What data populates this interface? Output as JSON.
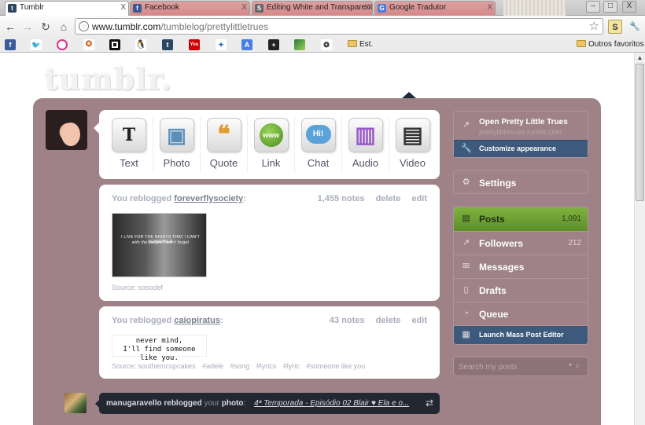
{
  "tabs": [
    {
      "title": "Tumblr",
      "favicon": "t"
    },
    {
      "title": "Facebook",
      "favicon": "f"
    },
    {
      "title": "Editing White and Transparent",
      "favicon": "S"
    },
    {
      "title": "Google Tradutor",
      "favicon": "G"
    }
  ],
  "window_controls": {
    "minimize": "–",
    "restore": "□",
    "close": "X"
  },
  "address_bar": {
    "domain": "www.tumblr.com",
    "path": "/tumblelog/prettylittletrues"
  },
  "bookmarks": {
    "folder1": "Est.",
    "other": "Outros favoritos"
  },
  "logo": "tumblr.",
  "composer": {
    "post_types": [
      {
        "label": "Text",
        "glyph": "T",
        "icon": "text-post-icon"
      },
      {
        "label": "Photo",
        "glyph": "▣",
        "icon": "photo-post-icon"
      },
      {
        "label": "Quote",
        "glyph": "❝",
        "icon": "quote-post-icon"
      },
      {
        "label": "Link",
        "glyph": "www",
        "icon": "link-post-icon"
      },
      {
        "label": "Chat",
        "glyph": "Hi!",
        "icon": "chat-post-icon"
      },
      {
        "label": "Audio",
        "glyph": "▥",
        "icon": "audio-post-icon"
      },
      {
        "label": "Video",
        "glyph": "▤",
        "icon": "video-post-icon"
      }
    ]
  },
  "posts": [
    {
      "prefix": "You reblogged",
      "user": "foreverflysociety",
      "colon": ":",
      "notes": "1,455 notes",
      "delete": "delete",
      "edit": "edit",
      "image_caption_1": "I LIVE FOR THE NIGHTS THAT I CAN'T REMEMBER",
      "image_caption_2": "with the people I won't forget",
      "source": "Source: sosodef"
    },
    {
      "prefix": "You reblogged",
      "user": "caiopiratus",
      "colon": ":",
      "notes": "43 notes",
      "delete": "delete",
      "edit": "edit",
      "image_line_1": "never mind,",
      "image_line_2": "I'll find someone like you.",
      "source": "Source: southerncupcakes",
      "tags": [
        "#adele",
        "#song",
        "#lyrics",
        "#lyric",
        "#someone like you"
      ]
    }
  ],
  "notification": {
    "user": "manugaravello",
    "action": "reblogged",
    "your": "your",
    "object": "photo",
    "colon": ":",
    "title": "4ª Temporada - Episódio 02 Blair ♥ Ela e o..."
  },
  "sidebar": {
    "blog_title": "Open Pretty Little Trues",
    "blog_url": "prettylittletrues.tumblr.com",
    "customize": "Customize appearance",
    "settings": "Settings",
    "posts": "Posts",
    "posts_count": "1,091",
    "followers": "Followers",
    "followers_count": "212",
    "messages": "Messages",
    "drafts": "Drafts",
    "queue": "Queue",
    "mass_editor": "Launch Mass Post Editor",
    "search_placeholder": "Search my posts",
    "search_option": "▾"
  },
  "colors": {
    "dashboard_bg": "#9e8287",
    "posts_active": "#6fa035",
    "customize_bg": "#3d5a7c"
  }
}
